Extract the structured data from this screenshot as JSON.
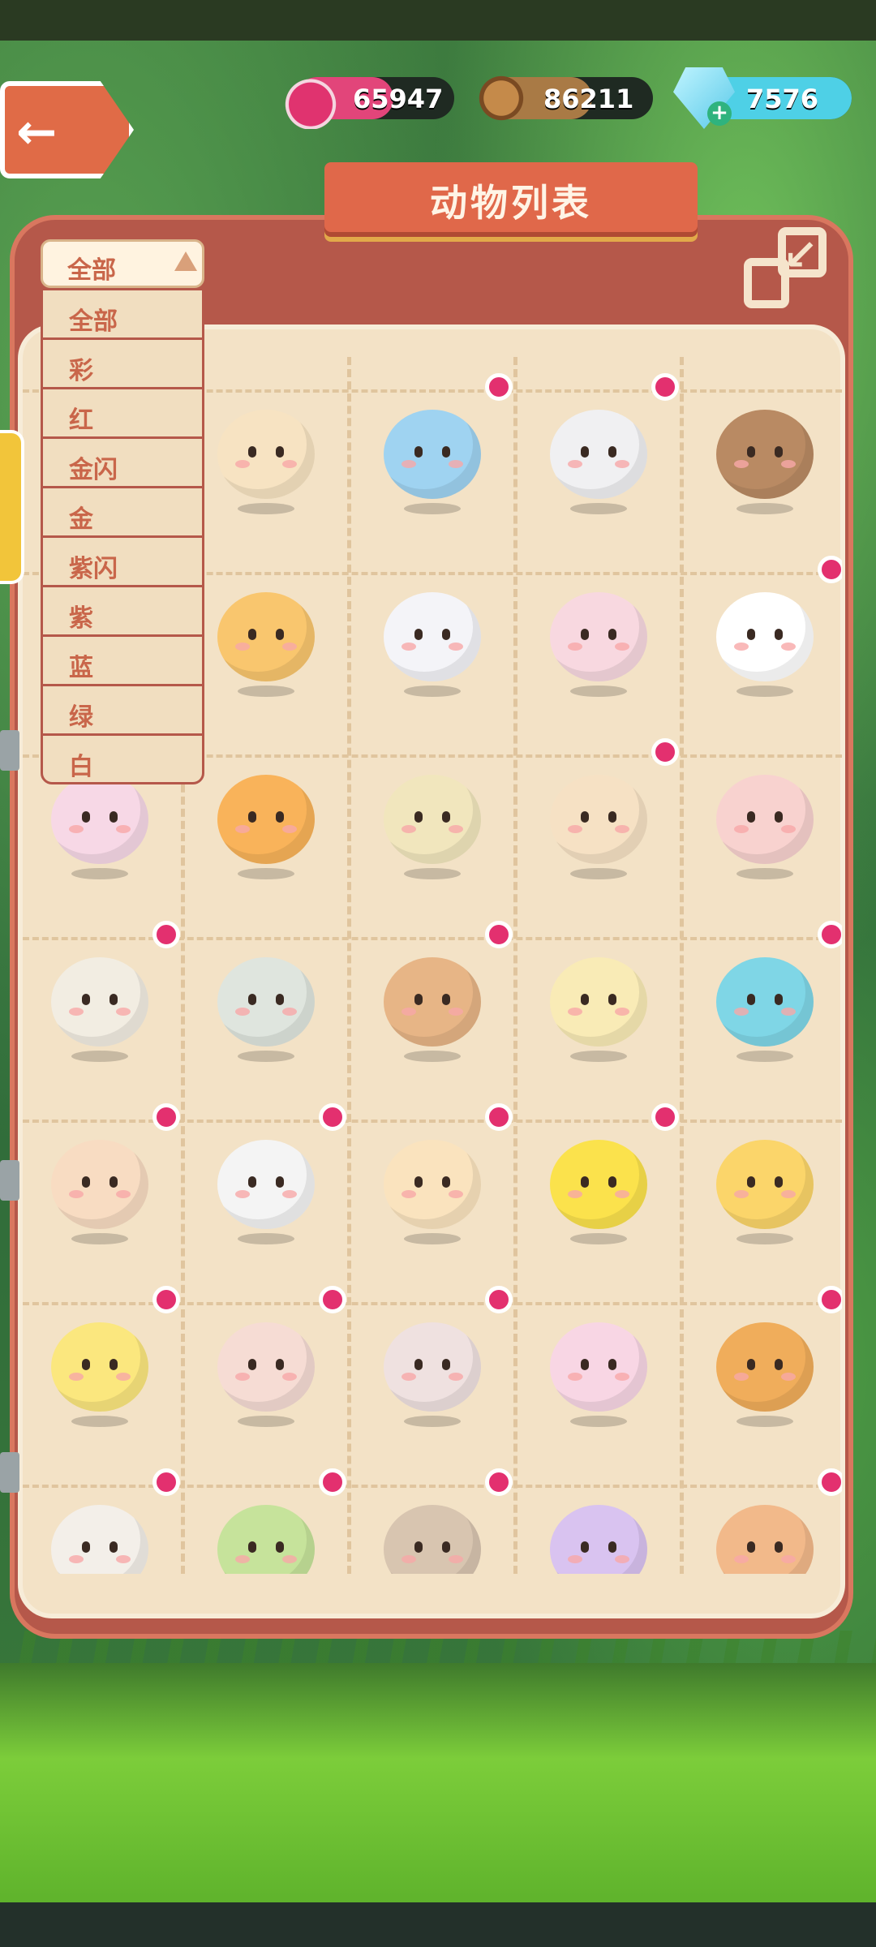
{
  "currencies": {
    "jam": {
      "value": "65947",
      "icon": "jam-jar-icon",
      "color": "#e2457a"
    },
    "wood": {
      "value": "86211",
      "icon": "wood-log-icon",
      "color": "#a97a45"
    },
    "gem": {
      "value": "7576",
      "icon": "diamond-icon",
      "color": "#4ed0e6"
    }
  },
  "header": {
    "title": "动物列表",
    "back_icon": "back-arrow-icon",
    "collapse_icon": "collapse-icon"
  },
  "filter": {
    "selected": "全部",
    "options": [
      "全部",
      "彩",
      "红",
      "金闪",
      "金",
      "紫闪",
      "紫",
      "蓝",
      "绿",
      "白"
    ]
  },
  "animals": [
    {
      "color": "#f4d5b8",
      "dot": false
    },
    {
      "color": "#f7e3c2",
      "dot": false
    },
    {
      "color": "#9fd3f1",
      "dot": true
    },
    {
      "color": "#f0f0f2",
      "dot": true
    },
    {
      "color": "#b98a63",
      "dot": false
    },
    {
      "color": "#f7d2c4",
      "dot": false
    },
    {
      "color": "#f9c66e",
      "dot": false
    },
    {
      "color": "#f4f4f8",
      "dot": false
    },
    {
      "color": "#f8d8e0",
      "dot": false
    },
    {
      "color": "#ffffff",
      "dot": true
    },
    {
      "color": "#f7d8e6",
      "dot": false
    },
    {
      "color": "#f9b35a",
      "dot": false
    },
    {
      "color": "#f1e6bd",
      "dot": false
    },
    {
      "color": "#f6e1c4",
      "dot": true
    },
    {
      "color": "#f8d2cf",
      "dot": false
    },
    {
      "color": "#f2ede2",
      "dot": true
    },
    {
      "color": "#dfe5de",
      "dot": false
    },
    {
      "color": "#e7b586",
      "dot": true
    },
    {
      "color": "#f9ebb6",
      "dot": false
    },
    {
      "color": "#7fd6e6",
      "dot": true
    },
    {
      "color": "#f8dcc2",
      "dot": true
    },
    {
      "color": "#f4f4f4",
      "dot": true
    },
    {
      "color": "#fae3be",
      "dot": true
    },
    {
      "color": "#fbe24c",
      "dot": true
    },
    {
      "color": "#fbd56a",
      "dot": false
    },
    {
      "color": "#fbe77e",
      "dot": true
    },
    {
      "color": "#f6dcd4",
      "dot": true
    },
    {
      "color": "#efe1e0",
      "dot": true
    },
    {
      "color": "#f8d6e4",
      "dot": false
    },
    {
      "color": "#f0ad5b",
      "dot": true
    },
    {
      "color": "#f3efe9",
      "dot": true
    },
    {
      "color": "#c6e39b",
      "dot": true
    },
    {
      "color": "#d8c5b0",
      "dot": true
    },
    {
      "color": "#d9c3f0",
      "dot": false
    },
    {
      "color": "#f2b98a",
      "dot": true
    }
  ]
}
